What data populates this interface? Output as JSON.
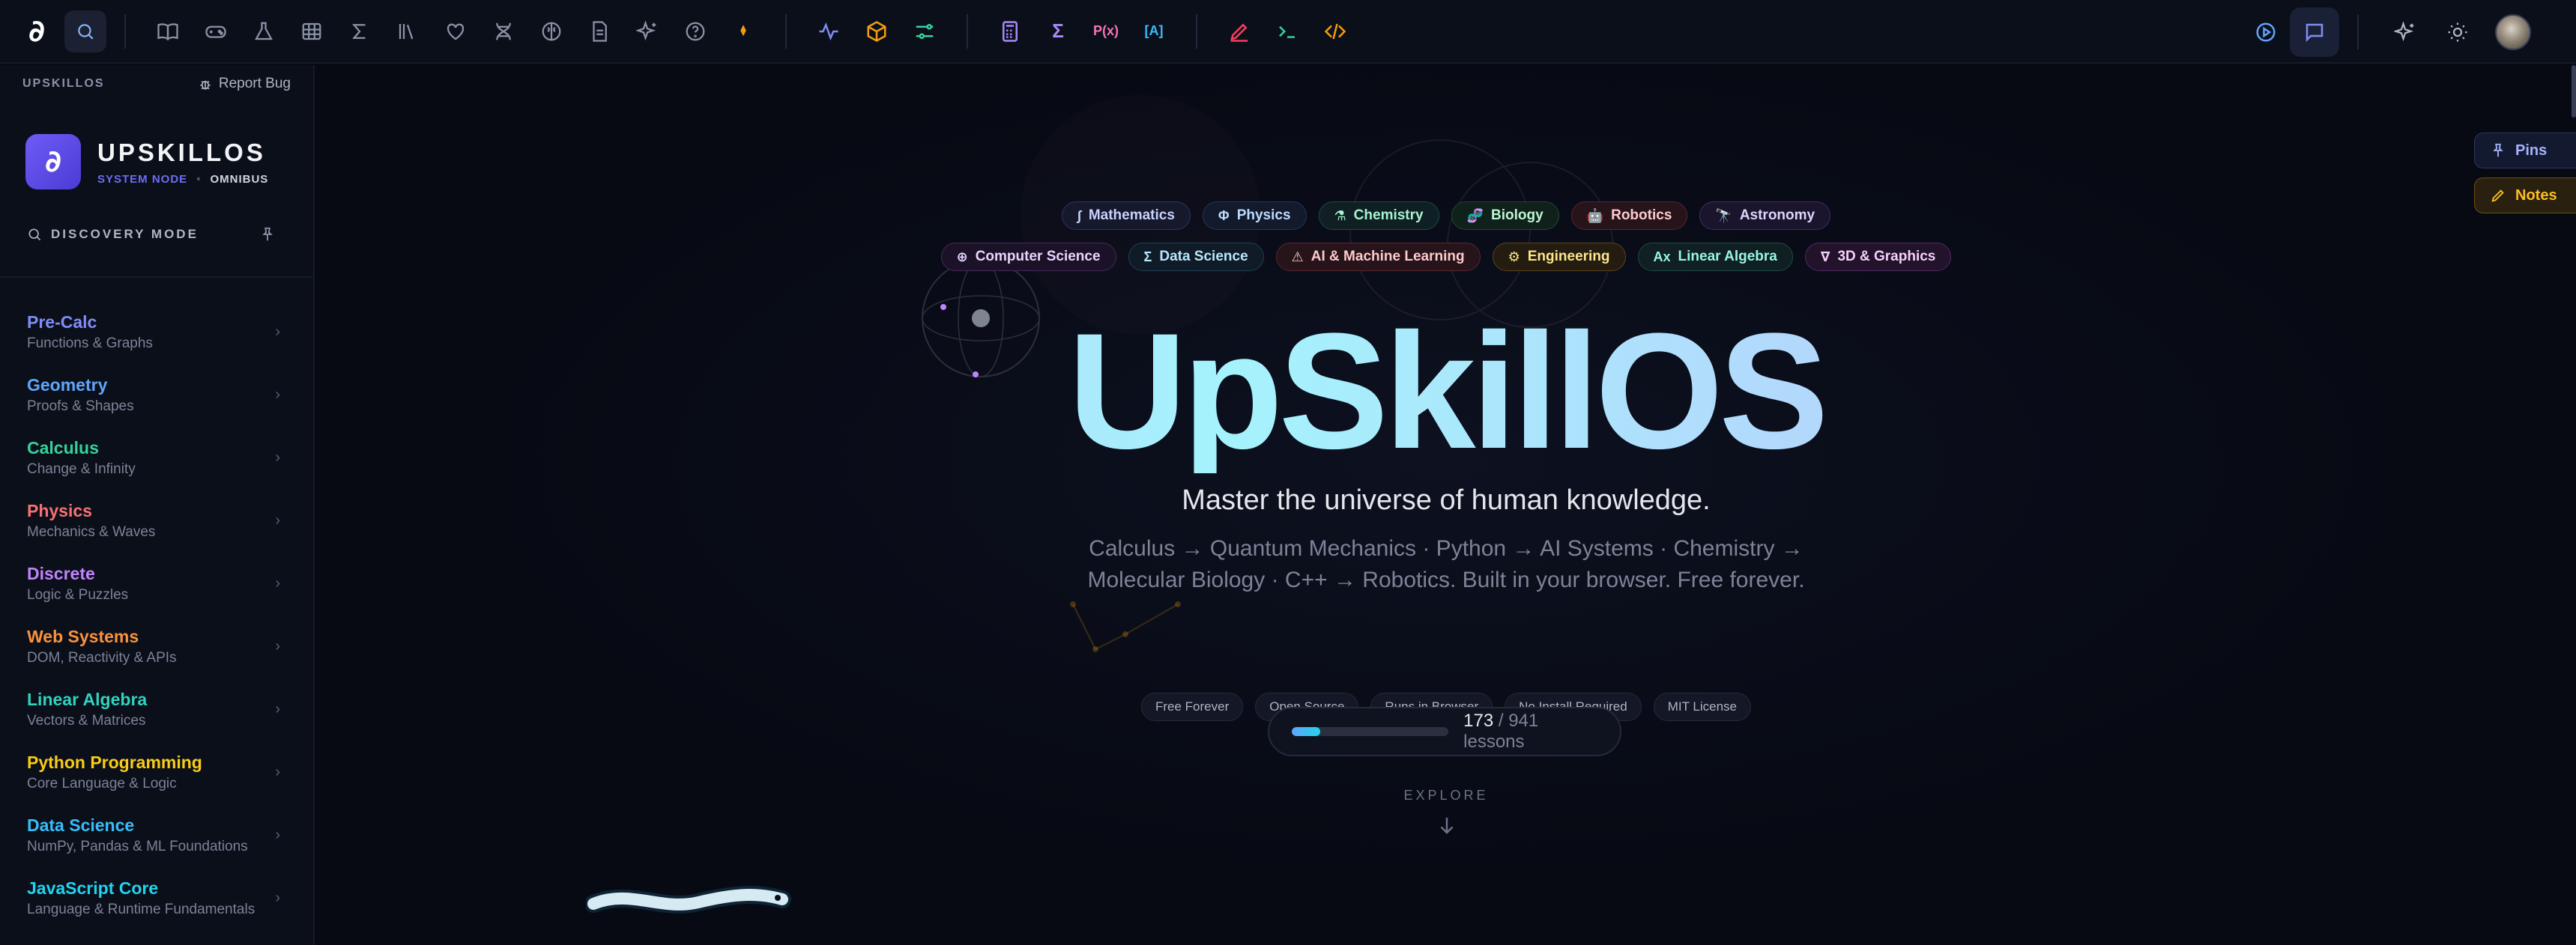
{
  "sidebar": {
    "brand_small": "UPSKILLOS",
    "report_bug": "Report Bug",
    "brand_title": "UPSKILLOS",
    "brand_node": "SYSTEM NODE",
    "brand_omni": "OMNIBUS",
    "discovery": "DISCOVERY MODE",
    "items": [
      {
        "name": "Pre-Calc",
        "desc": "Functions & Graphs",
        "color": "#818cf8"
      },
      {
        "name": "Geometry",
        "desc": "Proofs & Shapes",
        "color": "#60a5fa"
      },
      {
        "name": "Calculus",
        "desc": "Change & Infinity",
        "color": "#34d399"
      },
      {
        "name": "Physics",
        "desc": "Mechanics & Waves",
        "color": "#f87171"
      },
      {
        "name": "Discrete",
        "desc": "Logic & Puzzles",
        "color": "#c084fc"
      },
      {
        "name": "Web Systems",
        "desc": "DOM, Reactivity & APIs",
        "color": "#fb923c"
      },
      {
        "name": "Linear Algebra",
        "desc": "Vectors & Matrices",
        "color": "#2dd4bf"
      },
      {
        "name": "Python Programming",
        "desc": "Core Language & Logic",
        "color": "#facc15"
      },
      {
        "name": "Data Science",
        "desc": "NumPy, Pandas & ML Foundations",
        "color": "#38bdf8"
      },
      {
        "name": "JavaScript Core",
        "desc": "Language & Runtime Fundamentals",
        "color": "#22d3ee"
      }
    ]
  },
  "chips_row1": [
    {
      "icon": "∫",
      "label": "Mathematics",
      "fg": "#c7d2fe",
      "bg": "#16182c",
      "bd": "#2f3360"
    },
    {
      "icon": "Φ",
      "label": "Physics",
      "fg": "#bfdbfe",
      "bg": "#121a2c",
      "bd": "#25375a"
    },
    {
      "icon": "⚗",
      "label": "Chemistry",
      "fg": "#a7f3d0",
      "bg": "#0f1f24",
      "bd": "#1d4a45"
    },
    {
      "icon": "🧬",
      "label": "Biology",
      "fg": "#bbf7d0",
      "bg": "#10201a",
      "bd": "#1f4a30"
    },
    {
      "icon": "🤖",
      "label": "Robotics",
      "fg": "#fecaca",
      "bg": "#26141a",
      "bd": "#5a2430"
    },
    {
      "icon": "🔭",
      "label": "Astronomy",
      "fg": "#ddd6fe",
      "bg": "#1a142c",
      "bd": "#3e2d6a"
    }
  ],
  "chips_row2": [
    {
      "icon": "⊕",
      "label": "Computer Science",
      "fg": "#e9d5ff",
      "bg": "#1c1228",
      "bd": "#45285e"
    },
    {
      "icon": "Σ",
      "label": "Data Science",
      "fg": "#bae6fd",
      "bg": "#0f1b26",
      "bd": "#1f3f57"
    },
    {
      "icon": "⚠",
      "label": "AI & Machine Learning",
      "fg": "#fecaca",
      "bg": "#26141a",
      "bd": "#5a2430"
    },
    {
      "icon": "⚙",
      "label": "Engineering",
      "fg": "#fde68a",
      "bg": "#241c10",
      "bd": "#5a4418"
    },
    {
      "icon": "Ax",
      "label": "Linear Algebra",
      "fg": "#99f6e4",
      "bg": "#0f1f22",
      "bd": "#1d4a45"
    },
    {
      "icon": "∇",
      "label": "3D & Graphics",
      "fg": "#f5d0fe",
      "bg": "#22122a",
      "bd": "#512866"
    }
  ],
  "hero": {
    "title": "UpSkillOS",
    "tagline": "Master the universe of human knowledge.",
    "desc": "Calculus → Quantum Mechanics · Python → AI Systems · Chemistry → Molecular Biology · C++ → Robotics. Built in your browser. Free forever."
  },
  "badges": [
    "Free Forever",
    "Open Source",
    "Runs in Browser",
    "No Install Required",
    "MIT License"
  ],
  "progress": {
    "done": "173",
    "total": "/ 941 lessons",
    "fraction": 0.184
  },
  "explore": "EXPLORE",
  "side_pins": "Pins",
  "side_notes": "Notes"
}
